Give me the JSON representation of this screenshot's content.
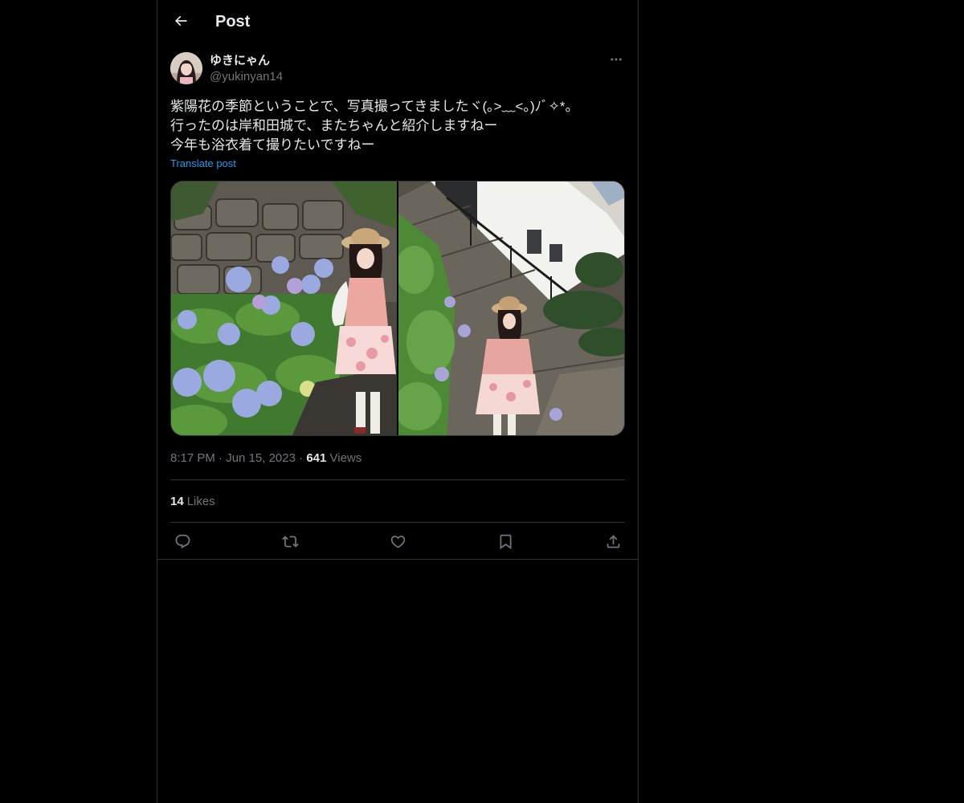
{
  "header": {
    "title": "Post"
  },
  "author": {
    "name": "ゆきにゃん",
    "handle": "@yukinyan14"
  },
  "post": {
    "text": "紫陽花の季節ということで、写真撮ってきましたヾ(｡>﹏<｡)ﾉﾞ✧*。\n行ったのは岸和田城で、またちゃんと紹介しますねー\n今年も浴衣着て撮りたいですねー",
    "translate_label": "Translate post",
    "time": "8:17 PM",
    "date": "Jun 15, 2023",
    "separator": "·",
    "views_count": "641",
    "views_label": "Views",
    "likes_count": "14",
    "likes_label": "Likes"
  },
  "media": [
    {
      "kind": "photo",
      "subject": "woman-with-hydrangeas"
    },
    {
      "kind": "photo",
      "subject": "woman-at-castle-stairs"
    }
  ],
  "actions": [
    "reply-icon",
    "repost-icon",
    "like-icon",
    "bookmark-icon",
    "share-icon"
  ],
  "colors": {
    "background": "#000000",
    "text": "#e7e9ea",
    "secondary": "#71767b",
    "link": "#1d9bf0",
    "border": "#2f3336"
  }
}
